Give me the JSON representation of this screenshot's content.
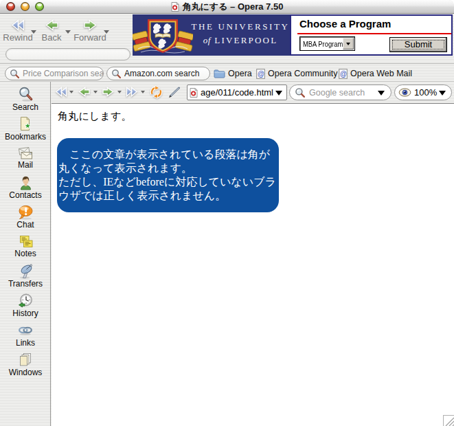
{
  "window": {
    "title": "角丸にする – Opera 7.50"
  },
  "toolbar": {
    "rewind_label": "Rewind",
    "back_label": "Back",
    "forward_label": "Forward"
  },
  "ad": {
    "university_line1": "THE UNIVERSITY",
    "university_of": "of",
    "university_line2": "LIVERPOOL",
    "heading": "Choose a Program",
    "select_value": "MBA Program",
    "submit_label": "Submit",
    "banner_color": "#2e3577",
    "redline_color": "#e10000"
  },
  "personal_bar": {
    "search1_placeholder": "Price Comparison search",
    "search2_value": "Amazon.com search",
    "opera_label": "Opera",
    "community_label": "Opera Community",
    "webmail_label": "Opera Web Mail"
  },
  "address_bar": {
    "url": "age/011/code.html",
    "google_placeholder": "Google search",
    "zoom_value": "100%"
  },
  "sidebar": {
    "items": [
      {
        "label": "Search"
      },
      {
        "label": "Bookmarks"
      },
      {
        "label": "Mail"
      },
      {
        "label": "Contacts"
      },
      {
        "label": "Chat"
      },
      {
        "label": "Notes"
      },
      {
        "label": "Transfers"
      },
      {
        "label": "History"
      },
      {
        "label": "Links"
      },
      {
        "label": "Windows"
      }
    ]
  },
  "content": {
    "heading": "角丸にします。",
    "box_line1": "ここの文章が表示されている段落は角が丸くなって表示されます。",
    "box_line2": "ただし、IEなどbeforeに対応していないブラウザでは正しく表示されません。",
    "box_color": "#0e509e"
  }
}
